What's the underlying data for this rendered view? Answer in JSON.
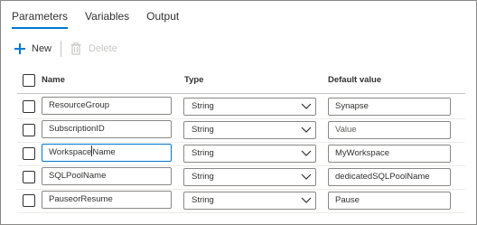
{
  "tabs": [
    {
      "label": "Parameters",
      "active": true
    },
    {
      "label": "Variables",
      "active": false
    },
    {
      "label": "Output",
      "active": false
    }
  ],
  "toolbar": {
    "new_label": "New",
    "delete_label": "Delete",
    "new_icon": "plus-icon",
    "delete_icon": "trash-icon"
  },
  "columns": {
    "name": "Name",
    "type": "Type",
    "default": "Default value"
  },
  "rows": [
    {
      "name": "ResourceGroup",
      "type": "String",
      "default_value": "Synapse",
      "default_placeholder": false
    },
    {
      "name": "SubscriptionID",
      "type": "String",
      "default_value": "Value",
      "default_placeholder": true
    },
    {
      "name": "WorkspaceName",
      "type": "String",
      "default_value": "MyWorkspace",
      "default_placeholder": false,
      "focused": true
    },
    {
      "name": "SQLPoolName",
      "type": "String",
      "default_value": "dedicatedSQLPoolName",
      "default_placeholder": false
    },
    {
      "name": "PauseorResume",
      "type": "String",
      "default_value": "Pause",
      "default_placeholder": false
    }
  ],
  "colors": {
    "accent": "#0078d4",
    "border": "#8a8886",
    "text": "#323130",
    "disabled": "#c8c6c4"
  }
}
